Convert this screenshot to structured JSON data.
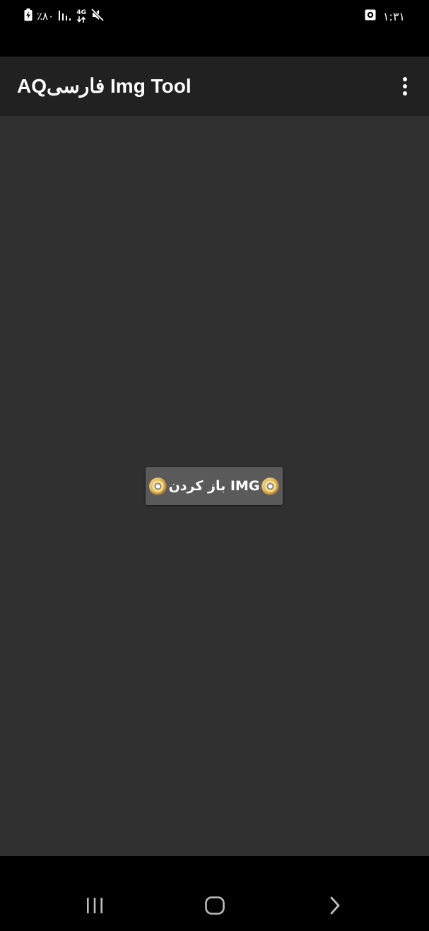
{
  "status_bar": {
    "battery_text": "٪۸۰",
    "network_type": "4G",
    "clock": "۱:۳۱",
    "icons": [
      "battery-charging-icon",
      "signal-icon",
      "network-4g-icon",
      "mute-icon",
      "alarm-icon"
    ]
  },
  "app_bar": {
    "title": "AQفارسی Img Tool",
    "overflow_icon": "more-vert-icon"
  },
  "main": {
    "open_button_label": "باز کردن IMG",
    "button_icon": "disc-icon"
  },
  "nav_bar": {
    "buttons": [
      "recent-apps-icon",
      "home-icon",
      "back-icon"
    ]
  },
  "colors": {
    "status_bar_bg": "#000000",
    "app_bar_bg": "#212121",
    "content_bg": "#303030",
    "button_bg": "#5a5a5a",
    "text": "#ffffff"
  }
}
